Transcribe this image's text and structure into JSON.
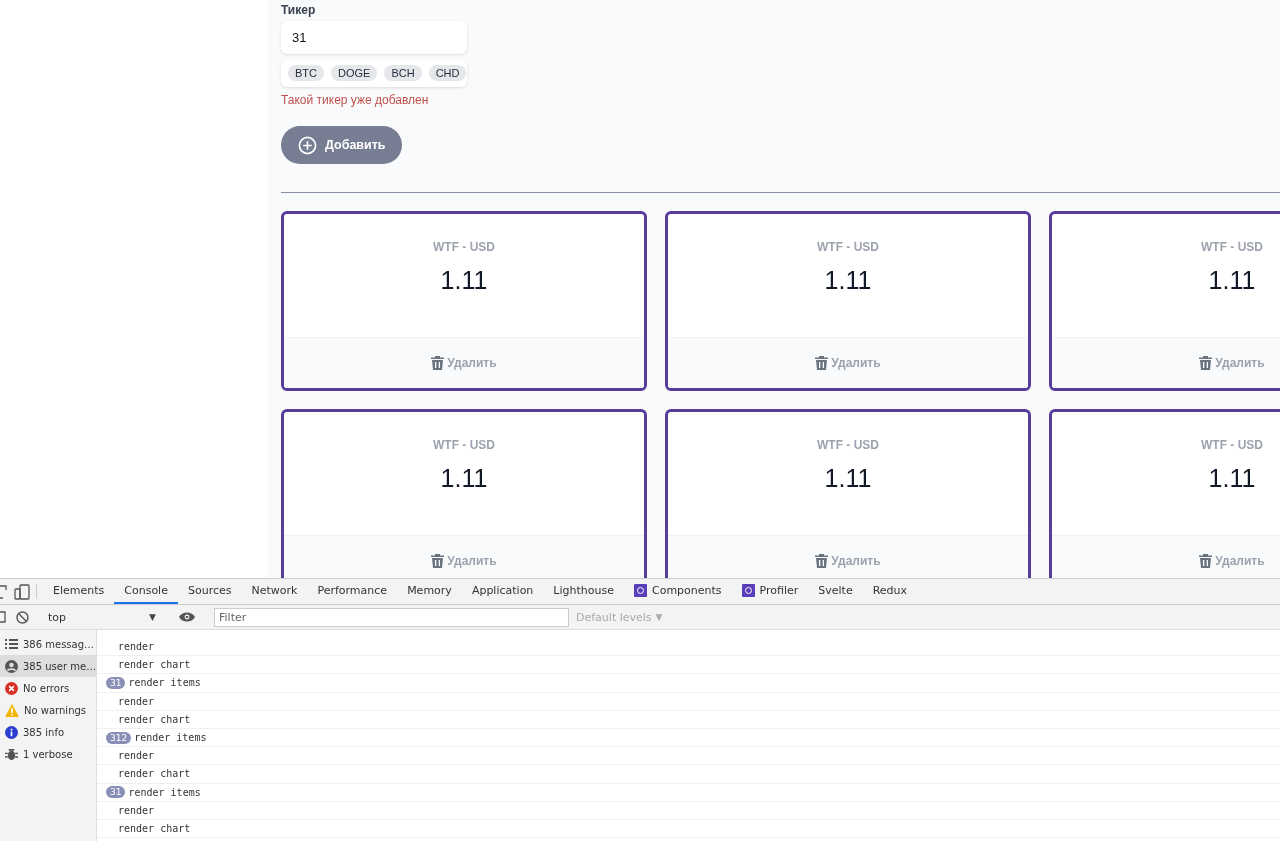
{
  "ticker_form": {
    "label": "Тикер",
    "value": "31",
    "suggestions": [
      "BTC",
      "DOGE",
      "BCH",
      "CHD"
    ],
    "error": "Такой тикер уже добавлен",
    "add_button": "Добавить"
  },
  "tickers": [
    {
      "name": "WTF - USD",
      "price": "1.11",
      "delete_button": "Удалить"
    },
    {
      "name": "WTF - USD",
      "price": "1.11",
      "delete_button": "Удалить"
    },
    {
      "name": "WTF - USD",
      "price": "1.11",
      "delete_button": "Удалить"
    },
    {
      "name": "WTF - USD",
      "price": "1.11",
      "delete_button": "Удалить"
    },
    {
      "name": "WTF - USD",
      "price": "1.11",
      "delete_button": "Удалить"
    },
    {
      "name": "WTF - USD",
      "price": "1.11",
      "delete_button": "Удалить"
    }
  ],
  "devtools": {
    "tabs": [
      {
        "label": "Elements",
        "kind": "builtin",
        "selected": false
      },
      {
        "label": "Console",
        "kind": "builtin",
        "selected": true
      },
      {
        "label": "Sources",
        "kind": "builtin",
        "selected": false
      },
      {
        "label": "Network",
        "kind": "builtin",
        "selected": false
      },
      {
        "label": "Performance",
        "kind": "builtin",
        "selected": false
      },
      {
        "label": "Memory",
        "kind": "builtin",
        "selected": false
      },
      {
        "label": "Application",
        "kind": "builtin",
        "selected": false
      },
      {
        "label": "Lighthouse",
        "kind": "builtin",
        "selected": false
      },
      {
        "label": "Components",
        "kind": "extension",
        "selected": false
      },
      {
        "label": "Profiler",
        "kind": "extension",
        "selected": false
      },
      {
        "label": "Svelte",
        "kind": "builtin",
        "selected": false
      },
      {
        "label": "Redux",
        "kind": "builtin",
        "selected": false
      }
    ],
    "context": "top",
    "context_caret": "▼",
    "filter_placeholder": "Filter",
    "levels": "Default levels",
    "levels_caret": "▼",
    "sidebar": [
      {
        "label": "386 messag…",
        "kind": "messages",
        "selected": false
      },
      {
        "label": "385 user me…",
        "kind": "user",
        "selected": true
      },
      {
        "label": "No errors",
        "kind": "errors",
        "selected": false
      },
      {
        "label": "No warnings",
        "kind": "warnings",
        "selected": false
      },
      {
        "label": "385 info",
        "kind": "info",
        "selected": false
      },
      {
        "label": "1 verbose",
        "kind": "verbose",
        "selected": false
      }
    ],
    "messages": [
      {
        "text": "render"
      },
      {
        "text": "render chart"
      },
      {
        "count": "31",
        "text": "render items"
      },
      {
        "text": "render"
      },
      {
        "text": "render chart"
      },
      {
        "count": "312",
        "text": "render items"
      },
      {
        "text": "render"
      },
      {
        "text": "render chart"
      },
      {
        "count": "31",
        "text": "render items"
      },
      {
        "text": "render"
      },
      {
        "text": "render chart"
      }
    ]
  }
}
